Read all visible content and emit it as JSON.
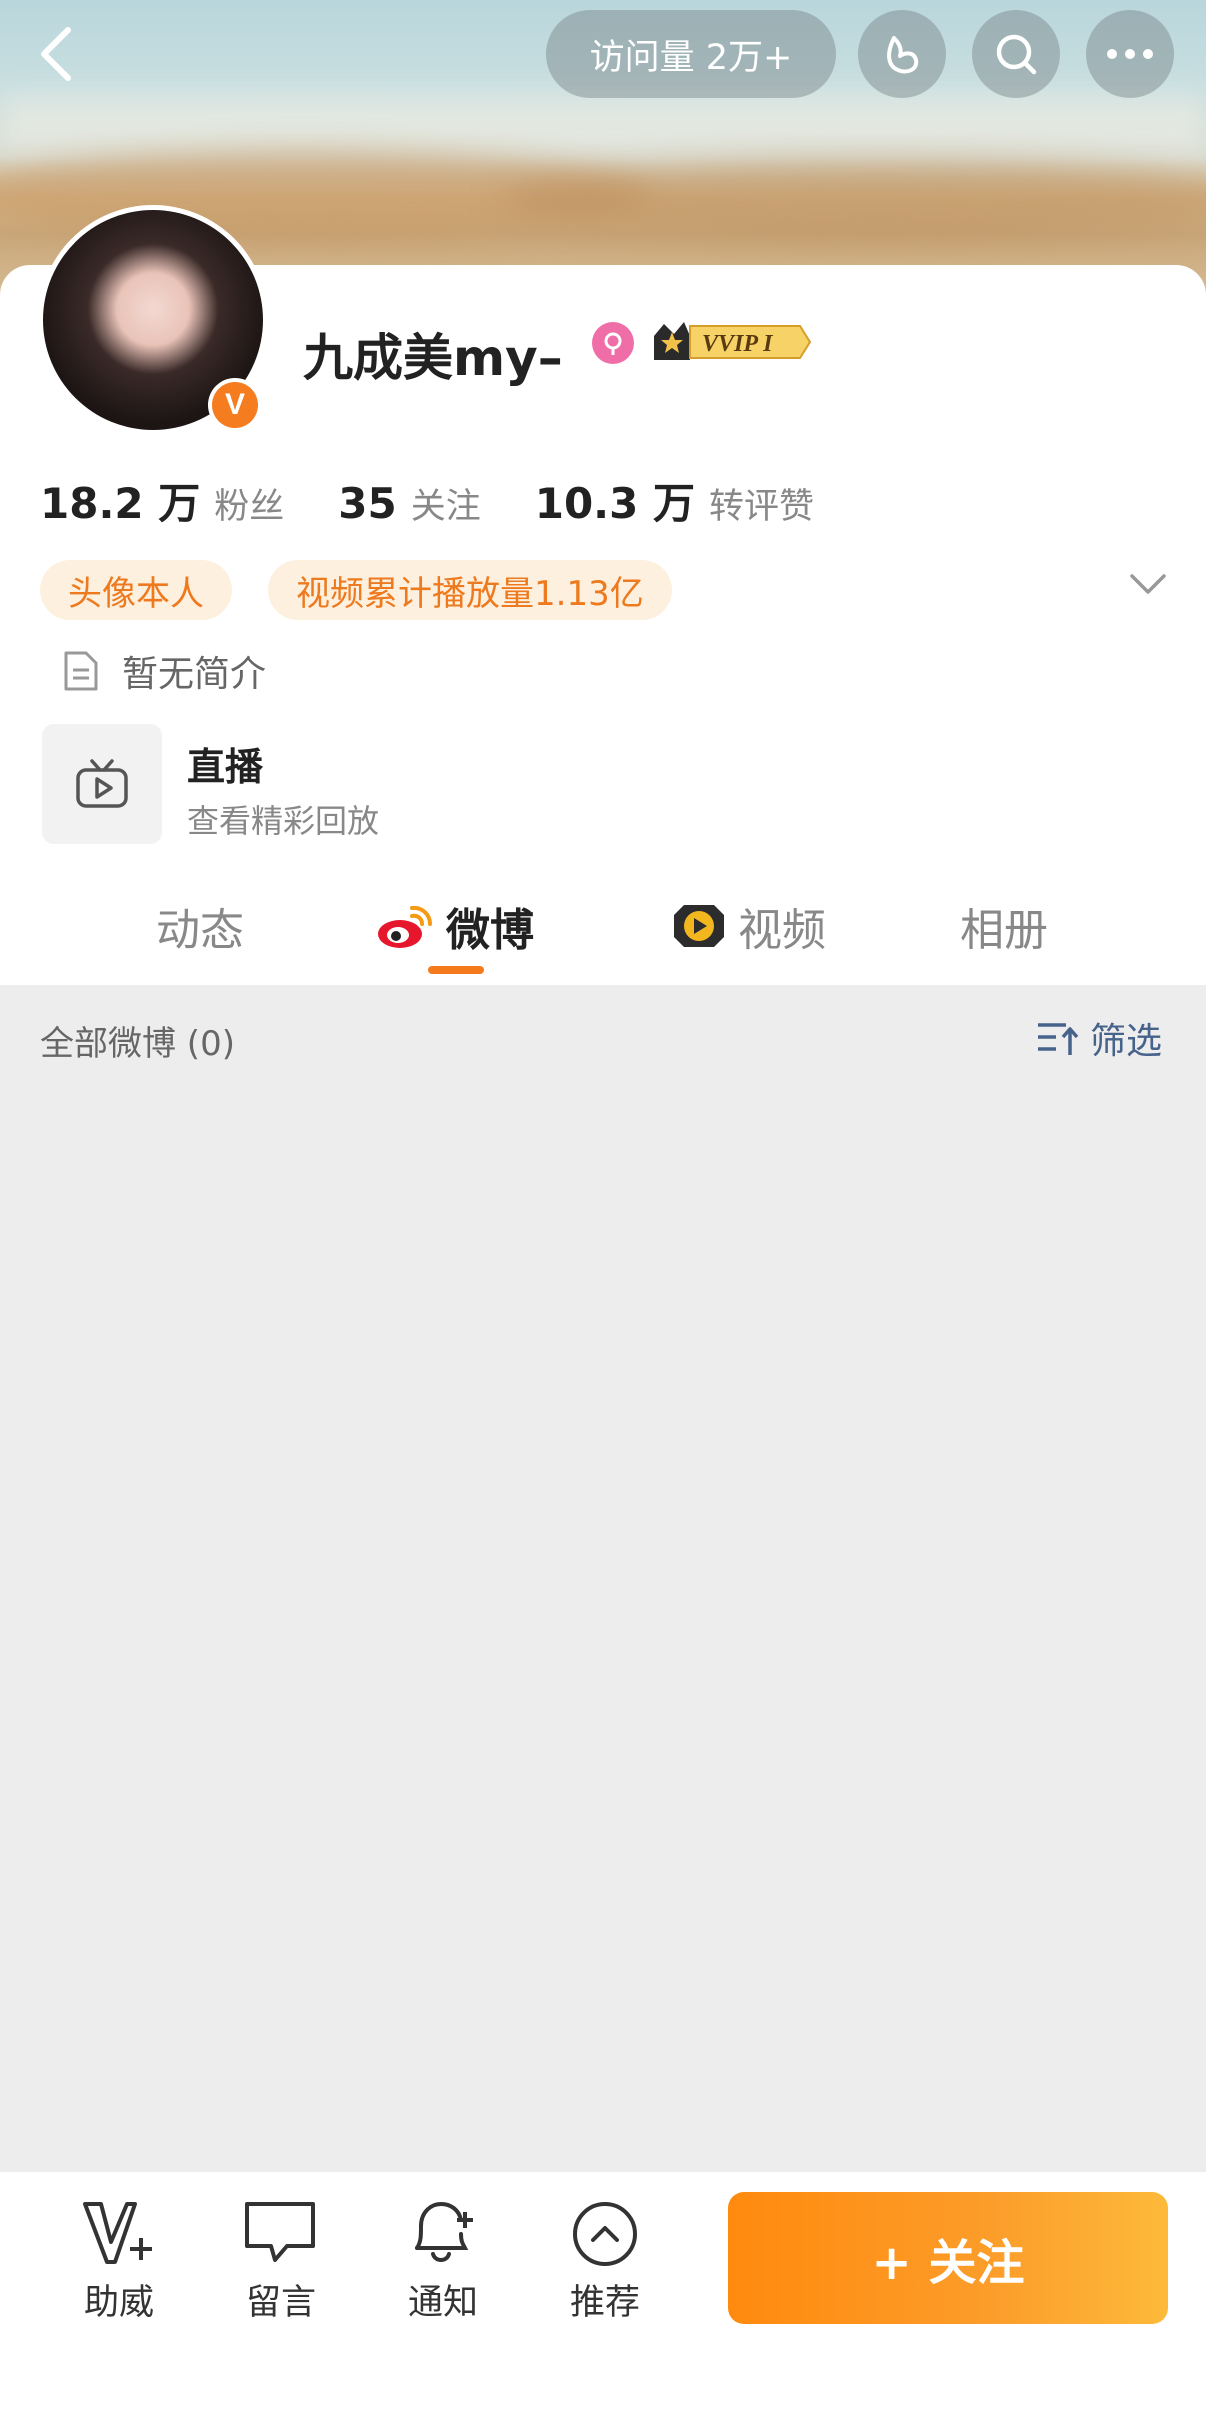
{
  "header": {
    "visits_label": "访问量 2万+",
    "back_icon": "back-arrow-icon",
    "gift_icon": "gift-icon",
    "search_icon": "search-icon",
    "more_icon": "more-icon"
  },
  "profile": {
    "username": "九成美my–",
    "verified_badge": "V",
    "vip_label": "VVIP I",
    "stats": [
      {
        "value": "18.2 万",
        "label": "粉丝"
      },
      {
        "value": "35",
        "label": "关注"
      },
      {
        "value": "10.3 万",
        "label": "转评赞"
      }
    ],
    "tags": [
      "头像本人",
      "视频累计播放量1.13亿"
    ],
    "intro": "暂无简介",
    "live": {
      "title": "直播",
      "subtitle": "查看精彩回放"
    }
  },
  "tabs": [
    {
      "label": "动态",
      "active": false
    },
    {
      "label": "微博",
      "active": true
    },
    {
      "label": "视频",
      "active": false
    },
    {
      "label": "相册",
      "active": false
    }
  ],
  "feed": {
    "header": "全部微博 (0)",
    "filter_label": "筛选"
  },
  "bottom_bar": {
    "items": [
      {
        "label": "助威",
        "icon": "cheer-icon"
      },
      {
        "label": "留言",
        "icon": "message-icon"
      },
      {
        "label": "通知",
        "icon": "notification-bell-icon"
      },
      {
        "label": "推荐",
        "icon": "recommend-icon"
      }
    ],
    "follow_label": "+ 关注"
  },
  "colors": {
    "accent": "#f57a1c",
    "tag_bg": "#fdf0de",
    "filter_blue": "#47628b"
  }
}
